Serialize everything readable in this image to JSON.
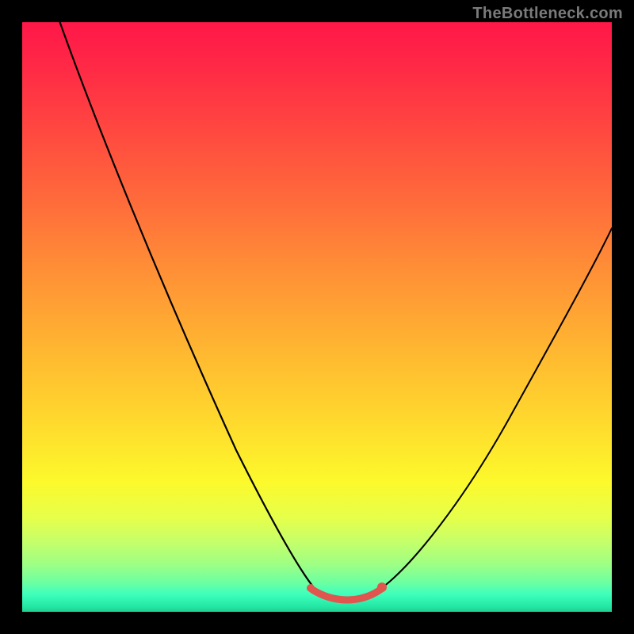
{
  "watermark": "TheBottleneck.com",
  "colors": {
    "background": "#000000",
    "curve": "#000000",
    "accent": "#e0554e"
  },
  "chart_data": {
    "type": "line",
    "title": "",
    "xlabel": "",
    "ylabel": "",
    "xlim": [
      0,
      100
    ],
    "ylim": [
      0,
      100
    ],
    "grid": false,
    "legend": false,
    "series": [
      {
        "name": "bottleneck-curve",
        "x": [
          0,
          6,
          12,
          18,
          24,
          30,
          36,
          42,
          48,
          50,
          52,
          54,
          56,
          58,
          60,
          66,
          72,
          78,
          84,
          90,
          96,
          100
        ],
        "y": [
          102,
          91,
          80,
          68,
          57,
          45,
          33,
          21,
          10,
          4,
          2,
          2,
          2,
          2,
          3,
          9,
          18,
          28,
          38,
          49,
          60,
          67
        ]
      }
    ],
    "annotations": [
      {
        "name": "optimal-range",
        "x_start": 50,
        "x_end": 60,
        "y": 2,
        "color": "#e0554e"
      }
    ],
    "background_gradient": {
      "orientation": "vertical",
      "stops": [
        {
          "pos": 0.0,
          "color": "#ff1748"
        },
        {
          "pos": 0.3,
          "color": "#ff6a3b"
        },
        {
          "pos": 0.55,
          "color": "#ffb531"
        },
        {
          "pos": 0.78,
          "color": "#fcf92c"
        },
        {
          "pos": 0.92,
          "color": "#9dff85"
        },
        {
          "pos": 1.0,
          "color": "#1fcf92"
        }
      ]
    }
  }
}
